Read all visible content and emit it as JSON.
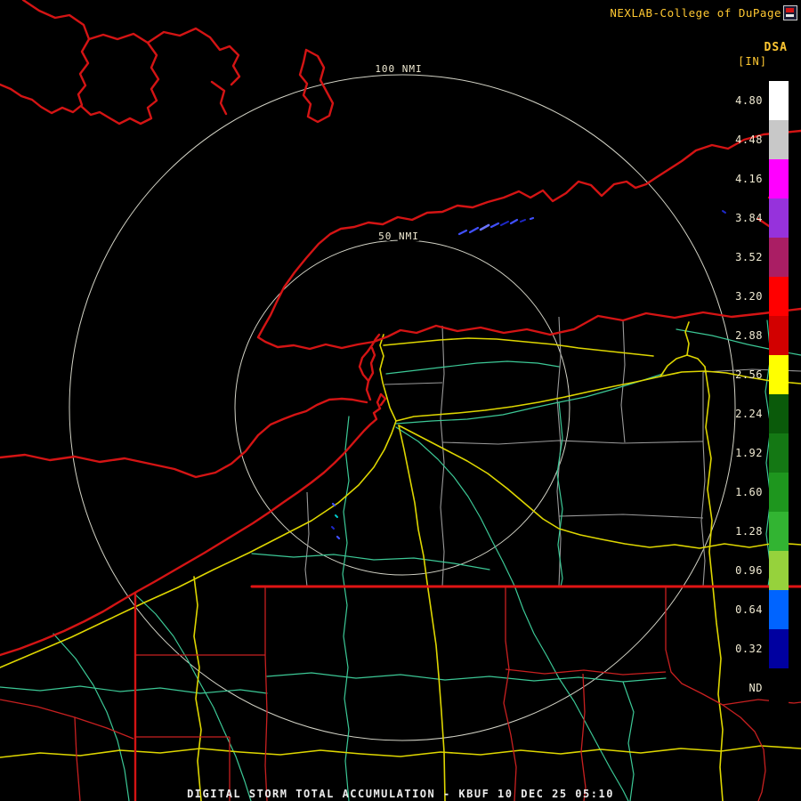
{
  "brand": {
    "text": "NEXLAB-College of DuPage",
    "color": "#ffc832"
  },
  "product": {
    "code": "DSA",
    "unit": "[IN]"
  },
  "colorbar": {
    "label_color": "#f0ead2",
    "segments": [
      {
        "label": "4.80",
        "color": "#ffffff"
      },
      {
        "label": "4.48",
        "color": "#c8c8c8"
      },
      {
        "label": "4.16",
        "color": "#ff00ff"
      },
      {
        "label": "3.84",
        "color": "#9632dc"
      },
      {
        "label": "3.52",
        "color": "#aa1e64"
      },
      {
        "label": "3.20",
        "color": "#ff0000"
      },
      {
        "label": "2.88",
        "color": "#d20000"
      },
      {
        "label": "2.56",
        "color": "#ffff00"
      },
      {
        "label": "2.24",
        "color": "#0a5a0a"
      },
      {
        "label": "1.92",
        "color": "#147814"
      },
      {
        "label": "1.60",
        "color": "#1e961e"
      },
      {
        "label": "1.28",
        "color": "#32b432"
      },
      {
        "label": "0.96",
        "color": "#96d23c"
      },
      {
        "label": "0.64",
        "color": "#0064ff"
      },
      {
        "label": "0.32",
        "color": "#0000a0"
      },
      {
        "label": "ND",
        "color": "#000000"
      }
    ]
  },
  "map": {
    "range_rings": [
      {
        "label": "100 NMI"
      },
      {
        "label": "50 NMI"
      }
    ],
    "colors": {
      "state_borders_shorelines": "#d41414",
      "county_lines": "#9a9a9a",
      "highways": "#ded600",
      "secondary_roads": "#3cc896",
      "range_rings": "#eaeadc",
      "precip_echoes": "#4050ff",
      "background": "#000000"
    }
  },
  "footer": {
    "text": "DIGITAL STORM TOTAL ACCUMULATION - KBUF 10 DEC 25 05:10"
  }
}
